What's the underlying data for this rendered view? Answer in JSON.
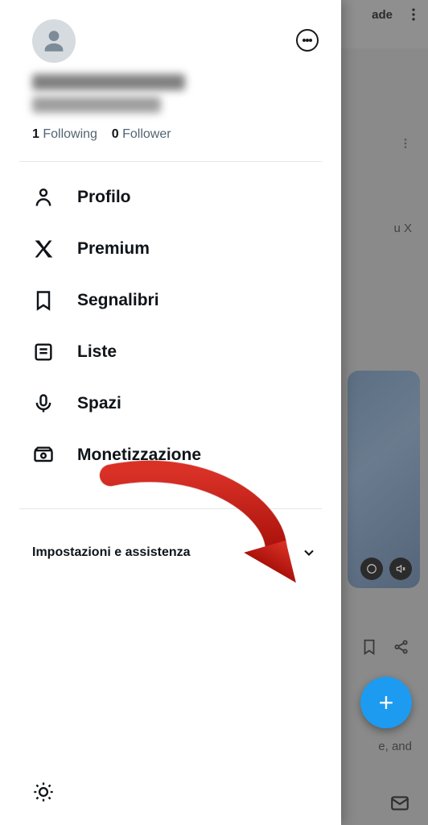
{
  "background": {
    "header_fragment": "ade",
    "post_text_fragment": "u X",
    "caption_fragment": "e, and"
  },
  "drawer": {
    "stats": {
      "following_count": "1",
      "following_label": "Following",
      "follower_count": "0",
      "follower_label": "Follower"
    },
    "menu": {
      "profile": "Profilo",
      "premium": "Premium",
      "bookmarks": "Segnalibri",
      "lists": "Liste",
      "spaces": "Spazi",
      "monetization": "Monetizzazione"
    },
    "settings_label": "Impostazioni e assistenza"
  },
  "colors": {
    "accent": "#1d9bf0",
    "text": "#0f1419",
    "muted": "#536471"
  }
}
